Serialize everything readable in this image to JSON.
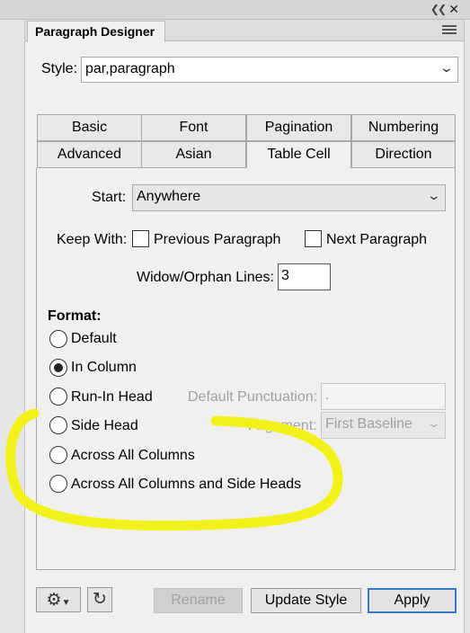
{
  "window": {
    "title": "Paragraph Designer",
    "collapse_icon": "double-chevron-icon",
    "close_icon": "close-icon",
    "menu_icon": "hamburger-icon"
  },
  "style_row": {
    "label": "Style:",
    "value": "par,paragraph"
  },
  "tabs": {
    "row1": [
      "Basic",
      "Font",
      "Pagination",
      "Numbering"
    ],
    "row2": [
      "Advanced",
      "Asian",
      "Table Cell",
      "Direction"
    ],
    "active": "Pagination"
  },
  "pagination": {
    "start_label": "Start:",
    "start_value": "Anywhere",
    "keep_with_label": "Keep With:",
    "keep_prev_label": "Previous Paragraph",
    "keep_prev_checked": false,
    "keep_next_label": "Next Paragraph",
    "keep_next_checked": false,
    "widow_label": "Widow/Orphan Lines:",
    "widow_value": "3",
    "format_label": "Format:",
    "format_options": [
      "Default",
      "In Column",
      "Run-In Head",
      "Side Head",
      "Across All Columns",
      "Across All Columns and Side Heads"
    ],
    "format_selected": "In Column",
    "default_punct_label": "Default Punctuation:",
    "default_punct_value": ".",
    "alignment_label": "Alignment:",
    "alignment_value": "First Baseline"
  },
  "footer": {
    "gear_icon": "gear-icon",
    "refresh_icon": "refresh-icon",
    "rename_label": "Rename",
    "update_label": "Update Style",
    "apply_label": "Apply"
  },
  "colors": {
    "highlight": "#f2f21a",
    "accent": "#3a78c9"
  }
}
